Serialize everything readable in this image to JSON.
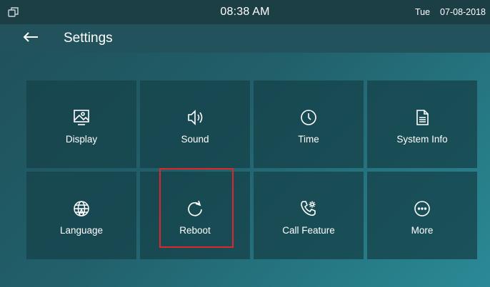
{
  "status": {
    "time": "08:38 AM",
    "day": "Tue",
    "date": "07-08-2018"
  },
  "header": {
    "title": "Settings"
  },
  "tiles": [
    {
      "label": "Display",
      "icon": "display-icon"
    },
    {
      "label": "Sound",
      "icon": "speaker-icon"
    },
    {
      "label": "Time",
      "icon": "clock-icon"
    },
    {
      "label": "System Info",
      "icon": "document-icon"
    },
    {
      "label": "Language",
      "icon": "globe-icon"
    },
    {
      "label": "Reboot",
      "icon": "refresh-icon"
    },
    {
      "label": "Call Feature",
      "icon": "phone-gear-icon"
    },
    {
      "label": "More",
      "icon": "more-dots-icon"
    }
  ],
  "highlight": {
    "target": "Reboot",
    "color": "#e0262b"
  },
  "colors": {
    "background": "#21606b",
    "tile": "#16424a",
    "statusbar": "#1c3f46"
  }
}
